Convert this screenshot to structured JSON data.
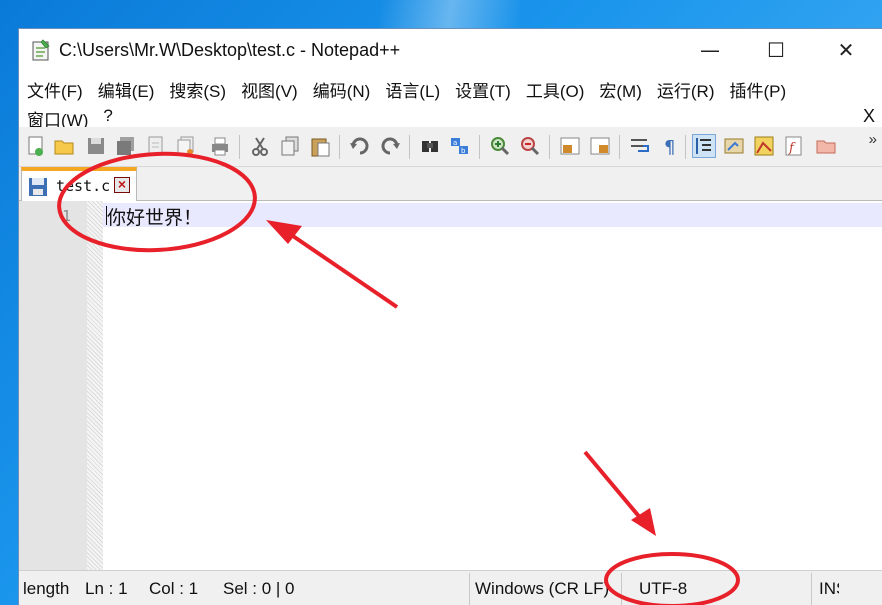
{
  "window": {
    "title": "C:\\Users\\Mr.W\\Desktop\\test.c - Notepad++",
    "minimize_glyph": "—",
    "maximize_glyph": "☐",
    "close_glyph": "✕"
  },
  "menu": {
    "row1": [
      "文件(F)",
      "编辑(E)",
      "搜索(S)",
      "视图(V)",
      "编码(N)",
      "语言(L)",
      "设置(T)",
      "工具(O)",
      "宏(M)",
      "运行(R)",
      "插件(P)"
    ],
    "row2": [
      "窗口(W)",
      "?"
    ],
    "close_doc": "X"
  },
  "toolbar": {
    "icons": [
      "new-file-icon",
      "open-file-icon",
      "save-icon",
      "save-all-icon",
      "close-icon",
      "close-all-icon",
      "print-icon",
      "cut-icon",
      "copy-icon",
      "paste-icon",
      "undo-icon",
      "redo-icon",
      "find-icon",
      "replace-icon",
      "zoom-in-icon",
      "zoom-out-icon",
      "sync-vertical-icon",
      "sync-horizontal-icon",
      "word-wrap-icon",
      "show-all-chars-icon",
      "indent-guide-icon",
      "udl-icon",
      "doc-map-icon",
      "function-list-icon",
      "folder-workspace-icon"
    ],
    "more": "»"
  },
  "tab": {
    "label": "test.c",
    "close_glyph": "×"
  },
  "editor": {
    "line_number": "1",
    "content": "你好世界！"
  },
  "status": {
    "doc_type": "length",
    "ln": "Ln : 1",
    "col": "Col : 1",
    "sel": "Sel : 0 | 0",
    "eol": "Windows (CR LF)",
    "encoding": "UTF-8",
    "mode": "INS"
  },
  "colors": {
    "accent_tab": "#f5a623",
    "current_line": "#e8e8ff",
    "annotation_red": "#e8202a",
    "desktop_blue": "#1a95ec"
  }
}
